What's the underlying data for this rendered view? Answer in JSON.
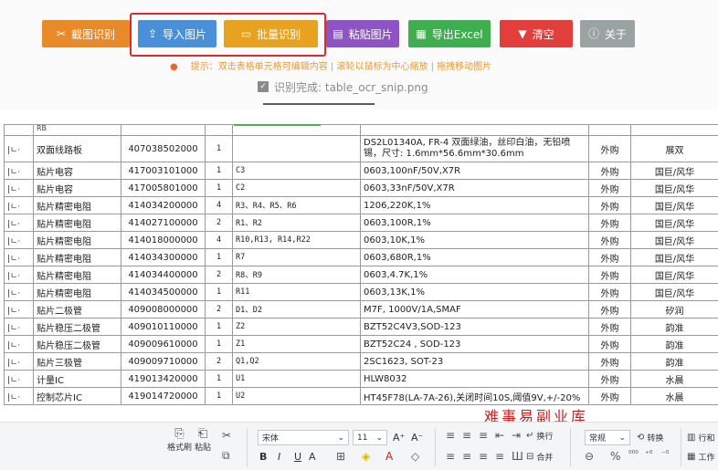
{
  "toolbar": {
    "snip": "截图识别",
    "import": "导入图片",
    "batch": "批量识别",
    "paste": "粘贴图片",
    "export": "导出Excel",
    "clear": "清空",
    "about": "关于"
  },
  "hint": "提示：双击表格单元格可编辑内容 | 滚轮以鼠标为中心缩放 | 拖拽移动图片",
  "status": "识别完成: table_ocr_snip.png",
  "table": {
    "partial_row": [
      "",
      "RB",
      "",
      "",
      "",
      "",
      "",
      ""
    ],
    "rows": [
      [
        "|ㄴ·",
        "双面线路板",
        "407038502000",
        "1",
        "",
        "DS2L01340A, FR-4 双面绿油，丝印白油，无铅喷锡，尺寸: 1.6mm*56.6mm*30.6mm",
        "外购",
        "展双"
      ],
      [
        "|ㄴ·",
        "贴片电容",
        "417003101000",
        "1",
        "C3",
        "0603,100nF/50V,X7R",
        "外购",
        "国巨/风华"
      ],
      [
        "|ㄴ·",
        "贴片电容",
        "417005801000",
        "1",
        "C2",
        "0603,33nF/50V,X7R",
        "外购",
        "国巨/风华"
      ],
      [
        "|ㄴ·",
        "贴片精密电阻",
        "414034200000",
        "4",
        "R3、R4、R5、R6",
        "1206,220K,1%",
        "外购",
        "国巨/风华"
      ],
      [
        "|ㄴ·",
        "贴片精密电阻",
        "414027100000",
        "2",
        "R1、R2",
        "0603,100R,1%",
        "外购",
        "国巨/风华"
      ],
      [
        "|ㄴ·",
        "贴片精密电阻",
        "414018000000",
        "4",
        "R10,R13, R14,R22",
        "0603,10K,1%",
        "外购",
        "国巨/风华"
      ],
      [
        "|ㄴ·",
        "贴片精密电阻",
        "414034300000",
        "1",
        "R7",
        "0603,680R,1%",
        "外购",
        "国巨/风华"
      ],
      [
        "|ㄴ·",
        "贴片精密电阻",
        "414034400000",
        "2",
        "R8、R9",
        "0603,4.7K,1%",
        "外购",
        "国巨/风华"
      ],
      [
        "|ㄴ·",
        "贴片精密电阻",
        "414034500000",
        "1",
        "R11",
        "0603,13K,1%",
        "外购",
        "国巨/风华"
      ],
      [
        "|ㄴ·",
        "贴片二极管",
        "409008000000",
        "2",
        "D1、D2",
        "M7F, 1000V/1A,SMAF",
        "外购",
        "矽润"
      ],
      [
        "|ㄴ·",
        "贴片稳压二极管",
        "409010110000",
        "1",
        "Z2",
        "BZT52C4V3,SOD-123",
        "外购",
        "韵准"
      ],
      [
        "|ㄴ·",
        "贴片稳压二极管",
        "409009610000",
        "1",
        "Z1",
        "BZT52C24 , SOD-123",
        "外购",
        "韵准"
      ],
      [
        "|ㄴ·",
        "贴片三极管",
        "409009710000",
        "2",
        "Q1,Q2",
        "2SC1623, SOT-23",
        "外购",
        "韵准"
      ],
      [
        "|ㄴ·",
        "计量IC",
        "419013420000",
        "1",
        "U1",
        "HLW8032",
        "外购",
        "水晨"
      ],
      [
        "|ㄴ·",
        "控制芯片IC",
        "419014720000",
        "1",
        "U2",
        "HT45F78(LA-7A-26),关闭时间10S,阈值9V,+/-20%",
        "外购",
        "水晨"
      ]
    ]
  },
  "watermark": "难事易副业库",
  "ribbon": {
    "format_painter": "格式刷",
    "paste": "粘贴",
    "font_name": "宋体",
    "font_size": "11",
    "grow": "A⁺",
    "shrink": "A⁻",
    "bold": "B",
    "italic": "I",
    "underline": "U",
    "strike": "A",
    "wrap": "换行",
    "merge": "合并",
    "number_format": "常规",
    "convert": "转换",
    "rows_cols": "行和",
    "worksheet": "工作"
  }
}
